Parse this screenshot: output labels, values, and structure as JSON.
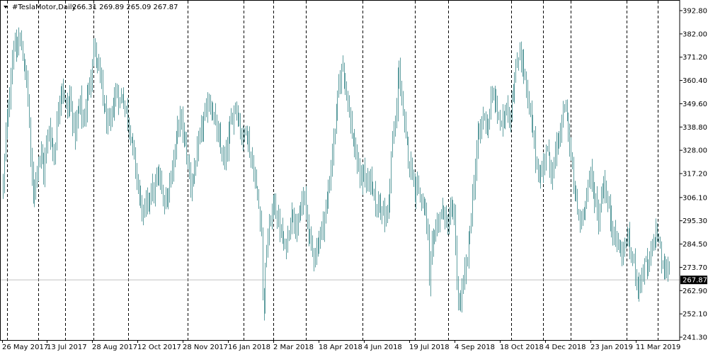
{
  "header": {
    "symbol": "#TeslaMotor,Daily",
    "ohlc": "266.31 269.89 265.09 267.87"
  },
  "chart_data": {
    "type": "ohlc-bars",
    "symbol": "#TeslaMotor",
    "timeframe": "Daily",
    "last_price": 267.87,
    "ylim": [
      241.3,
      392.8
    ],
    "y_ticks": [
      "392.80",
      "382.00",
      "371.20",
      "360.40",
      "349.60",
      "338.80",
      "328.00",
      "317.20",
      "306.10",
      "295.30",
      "284.50",
      "273.70",
      "262.90",
      "252.10",
      "241.30"
    ],
    "x_ticks": [
      "26 May 2017",
      "13 Jul 2017",
      "28 Aug 2017",
      "12 Oct 2017",
      "28 Nov 2017",
      "16 Jan 2018",
      "2 Mar 2018",
      "18 Apr 2018",
      "4 Jun 2018",
      "19 Jul 2018",
      "4 Sep 2018",
      "18 Oct 2018",
      "4 Dec 2018",
      "23 Jan 2019",
      "11 Mar 2019"
    ],
    "colors": {
      "bar": "#5f9ea0",
      "grid": "#000000",
      "price_line": "#c0c0c0",
      "price_label_bg": "#000000",
      "price_label_text": "#ffffff"
    },
    "grid": "vertical-dashed",
    "anchors": [
      [
        0,
        312
      ],
      [
        2,
        335
      ],
      [
        4,
        348
      ],
      [
        6,
        362
      ],
      [
        8,
        378
      ],
      [
        10,
        372
      ],
      [
        12,
        380
      ],
      [
        14,
        376
      ],
      [
        16,
        368
      ],
      [
        18,
        360
      ],
      [
        20,
        342
      ],
      [
        21,
        322
      ],
      [
        23,
        308
      ],
      [
        25,
        316
      ],
      [
        27,
        324
      ],
      [
        29,
        326
      ],
      [
        31,
        318
      ],
      [
        33,
        330
      ],
      [
        35,
        338
      ],
      [
        37,
        332
      ],
      [
        39,
        325
      ],
      [
        41,
        340
      ],
      [
        43,
        353
      ],
      [
        45,
        358
      ],
      [
        47,
        351
      ],
      [
        49,
        347
      ],
      [
        51,
        352
      ],
      [
        53,
        343
      ],
      [
        55,
        336
      ],
      [
        57,
        345
      ],
      [
        59,
        350
      ],
      [
        61,
        340
      ],
      [
        63,
        348
      ],
      [
        65,
        356
      ],
      [
        67,
        364
      ],
      [
        69,
        376
      ],
      [
        71,
        371
      ],
      [
        73,
        365
      ],
      [
        75,
        358
      ],
      [
        77,
        348
      ],
      [
        79,
        342
      ],
      [
        81,
        338
      ],
      [
        83,
        345
      ],
      [
        85,
        352
      ],
      [
        87,
        355
      ],
      [
        89,
        350
      ],
      [
        91,
        354
      ],
      [
        93,
        348
      ],
      [
        95,
        343
      ],
      [
        97,
        336
      ],
      [
        99,
        330
      ],
      [
        101,
        318
      ],
      [
        103,
        312
      ],
      [
        105,
        303
      ],
      [
        107,
        298
      ],
      [
        109,
        302
      ],
      [
        111,
        306
      ],
      [
        113,
        310
      ],
      [
        115,
        308
      ],
      [
        117,
        314
      ],
      [
        119,
        316
      ],
      [
        121,
        309
      ],
      [
        123,
        304
      ],
      [
        125,
        307
      ],
      [
        127,
        314
      ],
      [
        129,
        319
      ],
      [
        131,
        328
      ],
      [
        133,
        338
      ],
      [
        135,
        343
      ],
      [
        137,
        338
      ],
      [
        139,
        330
      ],
      [
        141,
        322
      ],
      [
        143,
        312
      ],
      [
        145,
        316
      ],
      [
        147,
        322
      ],
      [
        149,
        330
      ],
      [
        151,
        337
      ],
      [
        153,
        342
      ],
      [
        155,
        346
      ],
      [
        157,
        351
      ],
      [
        159,
        347
      ],
      [
        161,
        343
      ],
      [
        163,
        336
      ],
      [
        165,
        332
      ],
      [
        167,
        326
      ],
      [
        169,
        322
      ],
      [
        171,
        330
      ],
      [
        173,
        338
      ],
      [
        175,
        344
      ],
      [
        177,
        350
      ],
      [
        179,
        344
      ],
      [
        181,
        338
      ],
      [
        183,
        333
      ],
      [
        185,
        340
      ],
      [
        187,
        332
      ],
      [
        189,
        324
      ],
      [
        191,
        318
      ],
      [
        193,
        310
      ],
      [
        195,
        302
      ],
      [
        197,
        292
      ],
      [
        198,
        262
      ],
      [
        199,
        256
      ],
      [
        200,
        272
      ],
      [
        201,
        282
      ],
      [
        203,
        292
      ],
      [
        205,
        300
      ],
      [
        207,
        304
      ],
      [
        209,
        296
      ],
      [
        211,
        293
      ],
      [
        213,
        286
      ],
      [
        215,
        282
      ],
      [
        217,
        288
      ],
      [
        219,
        296
      ],
      [
        221,
        300
      ],
      [
        223,
        294
      ],
      [
        225,
        292
      ],
      [
        227,
        300
      ],
      [
        229,
        306
      ],
      [
        231,
        300
      ],
      [
        233,
        292
      ],
      [
        235,
        283
      ],
      [
        237,
        280
      ],
      [
        239,
        282
      ],
      [
        241,
        287
      ],
      [
        243,
        292
      ],
      [
        245,
        297
      ],
      [
        247,
        304
      ],
      [
        249,
        314
      ],
      [
        251,
        327
      ],
      [
        253,
        338
      ],
      [
        255,
        352
      ],
      [
        257,
        362
      ],
      [
        259,
        368
      ],
      [
        261,
        360
      ],
      [
        263,
        350
      ],
      [
        265,
        340
      ],
      [
        267,
        332
      ],
      [
        269,
        324
      ],
      [
        271,
        320
      ],
      [
        273,
        314
      ],
      [
        275,
        318
      ],
      [
        277,
        312
      ],
      [
        279,
        316
      ],
      [
        281,
        310
      ],
      [
        283,
        306
      ],
      [
        285,
        300
      ],
      [
        287,
        306
      ],
      [
        289,
        300
      ],
      [
        291,
        296
      ],
      [
        293,
        300
      ],
      [
        295,
        312
      ],
      [
        296,
        326
      ],
      [
        298,
        336
      ],
      [
        300,
        346
      ],
      [
        301,
        360
      ],
      [
        302,
        368
      ],
      [
        304,
        350
      ],
      [
        306,
        338
      ],
      [
        308,
        330
      ],
      [
        310,
        322
      ],
      [
        312,
        318
      ],
      [
        314,
        310
      ],
      [
        316,
        314
      ],
      [
        318,
        306
      ],
      [
        320,
        302
      ],
      [
        322,
        300
      ],
      [
        324,
        286
      ],
      [
        325,
        264
      ],
      [
        326,
        276
      ],
      [
        328,
        288
      ],
      [
        330,
        292
      ],
      [
        332,
        296
      ],
      [
        334,
        298
      ],
      [
        336,
        300
      ],
      [
        338,
        292
      ],
      [
        340,
        296
      ],
      [
        342,
        302
      ],
      [
        344,
        295
      ],
      [
        345,
        282
      ],
      [
        346,
        265
      ],
      [
        347,
        260
      ],
      [
        348,
        256
      ],
      [
        350,
        262
      ],
      [
        352,
        270
      ],
      [
        354,
        278
      ],
      [
        356,
        292
      ],
      [
        358,
        306
      ],
      [
        360,
        320
      ],
      [
        362,
        334
      ],
      [
        364,
        338
      ],
      [
        366,
        344
      ],
      [
        368,
        342
      ],
      [
        370,
        340
      ],
      [
        372,
        350
      ],
      [
        374,
        354
      ],
      [
        376,
        348
      ],
      [
        378,
        344
      ],
      [
        380,
        338
      ],
      [
        382,
        344
      ],
      [
        384,
        350
      ],
      [
        386,
        342
      ],
      [
        388,
        352
      ],
      [
        390,
        360
      ],
      [
        392,
        368
      ],
      [
        394,
        375
      ],
      [
        396,
        368
      ],
      [
        398,
        362
      ],
      [
        400,
        350
      ],
      [
        402,
        344
      ],
      [
        404,
        336
      ],
      [
        406,
        325
      ],
      [
        408,
        318
      ],
      [
        410,
        315
      ],
      [
        412,
        322
      ],
      [
        414,
        330
      ],
      [
        416,
        324
      ],
      [
        418,
        318
      ],
      [
        420,
        322
      ],
      [
        422,
        328
      ],
      [
        424,
        334
      ],
      [
        426,
        340
      ],
      [
        428,
        348
      ],
      [
        430,
        345
      ],
      [
        432,
        330
      ],
      [
        434,
        318
      ],
      [
        436,
        308
      ],
      [
        438,
        300
      ],
      [
        440,
        294
      ],
      [
        442,
        298
      ],
      [
        444,
        306
      ],
      [
        446,
        312
      ],
      [
        448,
        316
      ],
      [
        450,
        310
      ],
      [
        452,
        304
      ],
      [
        454,
        296
      ],
      [
        456,
        306
      ],
      [
        458,
        314
      ],
      [
        460,
        306
      ],
      [
        462,
        300
      ],
      [
        464,
        294
      ],
      [
        466,
        290
      ],
      [
        468,
        286
      ],
      [
        470,
        282
      ],
      [
        472,
        280
      ],
      [
        474,
        284
      ],
      [
        476,
        288
      ],
      [
        478,
        282
      ],
      [
        480,
        278
      ],
      [
        482,
        272
      ],
      [
        484,
        266
      ],
      [
        486,
        268
      ],
      [
        488,
        272
      ],
      [
        490,
        276
      ],
      [
        492,
        272
      ],
      [
        494,
        280
      ],
      [
        496,
        286
      ],
      [
        498,
        290
      ],
      [
        500,
        287
      ],
      [
        502,
        276
      ],
      [
        504,
        271
      ],
      [
        506,
        274
      ],
      [
        508,
        272
      ]
    ]
  }
}
